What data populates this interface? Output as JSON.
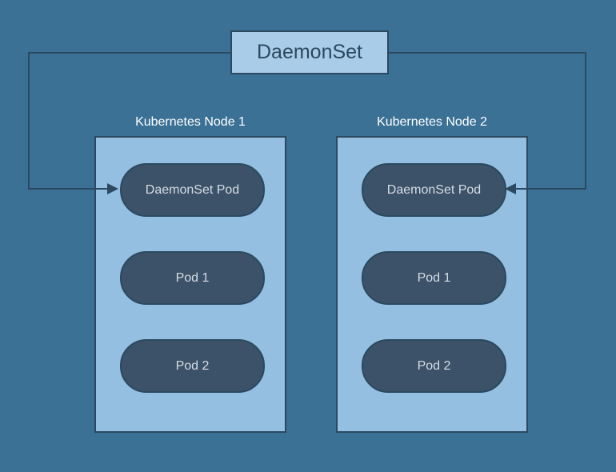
{
  "daemonset": {
    "title": "DaemonSet"
  },
  "nodes": [
    {
      "label": "Kubernetes Node 1",
      "pods": {
        "daemon": "DaemonSet Pod",
        "pod1": "Pod 1",
        "pod2": "Pod 2"
      }
    },
    {
      "label": "Kubernetes Node 2",
      "pods": {
        "daemon": "DaemonSet Pod",
        "pod1": "Pod 1",
        "pod2": "Pod 2"
      }
    }
  ]
}
